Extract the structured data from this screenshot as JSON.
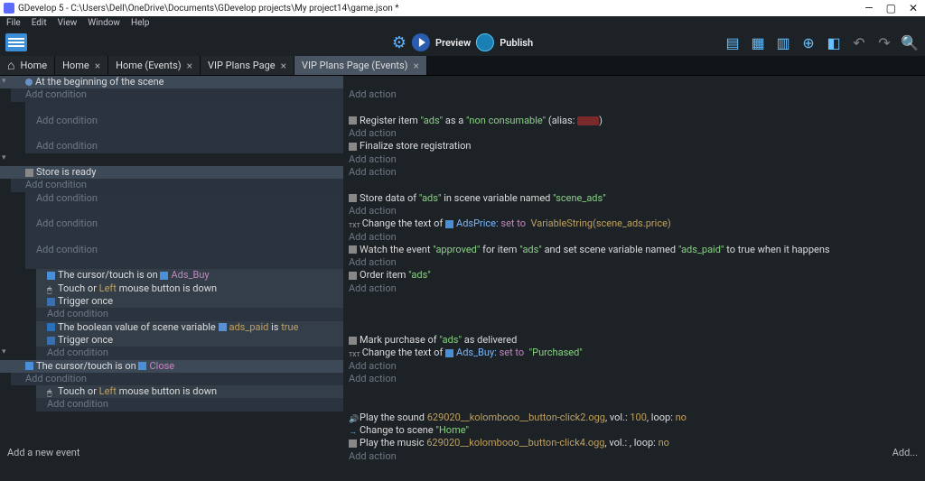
{
  "window": {
    "title": "GDevelop 5 - C:\\Users\\Dell\\OneDrive\\Documents\\GDevelop projects\\My project14\\game.json *"
  },
  "menu": {
    "file": "File",
    "edit": "Edit",
    "view": "View",
    "window": "Window",
    "help": "Help"
  },
  "toolbar": {
    "preview": "Preview",
    "publish": "Publish"
  },
  "tabs": [
    {
      "label": "Home",
      "icon": true,
      "closable": false
    },
    {
      "label": "Home",
      "closable": true
    },
    {
      "label": "Home (Events)",
      "closable": true
    },
    {
      "label": "VIP Plans Page",
      "closable": true
    },
    {
      "label": "VIP Plans Page (Events)",
      "closable": true,
      "active": true
    }
  ],
  "strings": {
    "add_condition": "Add condition",
    "add_action": "Add action",
    "add_event": "Add a new event",
    "add_right": "Add..."
  },
  "events": {
    "begin": {
      "header": "At the beginning of the scene"
    },
    "register": {
      "pre": "Register item ",
      "ads": "\"ads\"",
      "mid": " as a ",
      "nc": "\"non consumable\"",
      "alias": " (alias: ",
      "close": ")"
    },
    "finalize": "Finalize store registration",
    "store_ready": "Store is ready",
    "store_data": {
      "pre": "Store data of ",
      "ads": "\"ads\"",
      "mid": " in scene variable named ",
      "var": "\"scene_ads\""
    },
    "change_adsprice": {
      "pre": "Change the text of ",
      "obj": "AdsPrice:",
      "setto": "set to",
      "val": "VariableString(scene_ads.price)"
    },
    "watch": {
      "pre": "Watch the event ",
      "approved": "\"approved\"",
      "mid": " for item ",
      "ads": "\"ads\"",
      "mid2": " and set scene variable named ",
      "var": "\"ads_paid\"",
      "end": " to true when it happens"
    },
    "order": {
      "pre": "Order item ",
      "ads": "\"ads\""
    },
    "cursor_adsbuy": {
      "pre": "The cursor/touch is on ",
      "obj": "Ads_Buy"
    },
    "touch_left": {
      "pre": "Touch or ",
      "left": "Left",
      "end": " mouse button is down"
    },
    "trigger_once": "Trigger once",
    "bool": {
      "pre": "The boolean value of scene variable ",
      "var": "ads_paid",
      "mid": " is ",
      "true": "true"
    },
    "mark": {
      "pre": "Mark purchase of ",
      "ads": "\"ads\"",
      "end": " as delivered"
    },
    "change_adsbuy": {
      "pre": "Change the text of ",
      "obj": "Ads_Buy:",
      "setto": "set to",
      "val": "\"Purchased\""
    },
    "cursor_close": {
      "pre": "The cursor/touch is on ",
      "obj": "Close"
    },
    "play_sound": {
      "pre": "Play the sound ",
      "file": "629020__kolombooo__button-click2.ogg",
      "mid": ", vol.: ",
      "vol": "100",
      "mid2": ", loop: ",
      "loop": "no"
    },
    "change_scene": {
      "pre": "Change to scene ",
      "home": "\"Home\""
    },
    "play_music": {
      "pre": "Play the music ",
      "file": "629020__kolombooo__button-click4.ogg",
      "mid": ", vol.: , loop: ",
      "loop": "no"
    }
  }
}
